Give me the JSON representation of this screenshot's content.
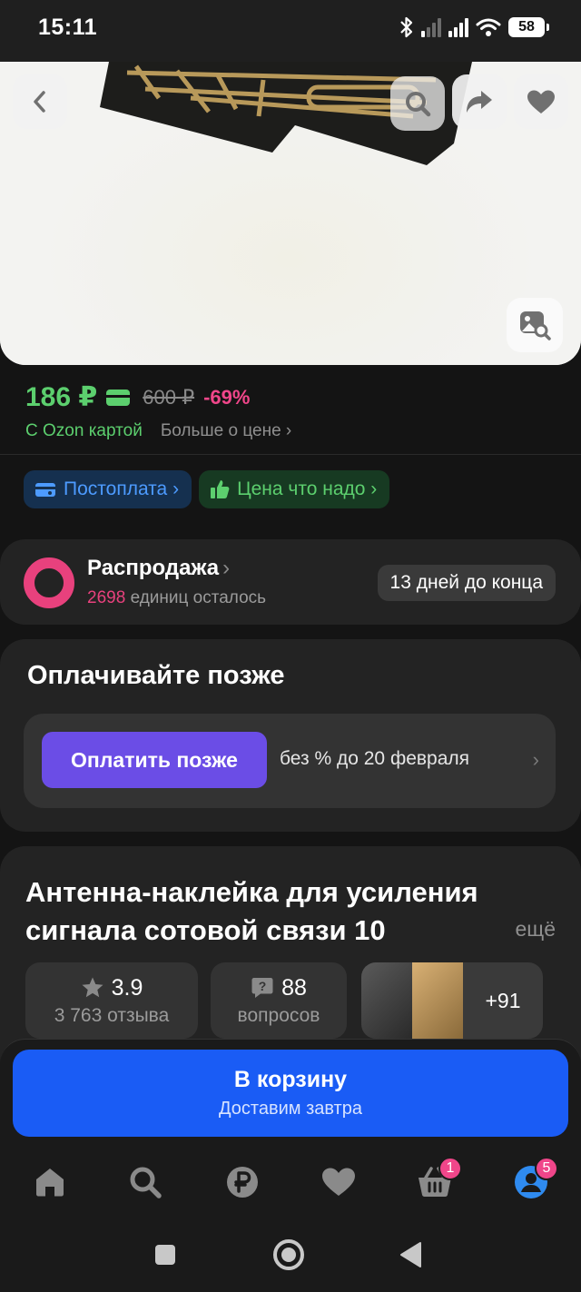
{
  "status_bar": {
    "time": "15:11",
    "battery": "58"
  },
  "price": {
    "current": "186 ₽",
    "old": "600 ₽",
    "discount": "-69%",
    "card_label": "С Ozon картой",
    "more_label": "Больше о цене ›"
  },
  "tags": [
    {
      "label": "Постоплата ›"
    },
    {
      "label": "Цена что надо ›"
    }
  ],
  "sale": {
    "title": "Распродажа",
    "count": "2698",
    "remaining_label": "единиц осталось",
    "days_left": "13 дней до конца"
  },
  "pay_later": {
    "title": "Оплачивайте позже",
    "button": "Оплатить позже",
    "text": "без % до 20 февраля"
  },
  "product": {
    "title": "Антенна-наклейка для усиления сигнала сотовой связи 10",
    "more": "ещё",
    "rating": "3.9",
    "reviews": "3 763 отзыва",
    "questions": "88",
    "questions_label": "вопросов",
    "photos_more": "+91"
  },
  "cart": {
    "label": "В корзину",
    "delivery": "Доставим завтра"
  },
  "tabbar": {
    "cart_badge": "1",
    "profile_badge": "5"
  },
  "colors": {
    "price_green": "#5ccf6e",
    "discount_pink": "#f0468a",
    "cart_blue": "#1a5cf5",
    "pay_later_purple": "#6b4de6"
  }
}
